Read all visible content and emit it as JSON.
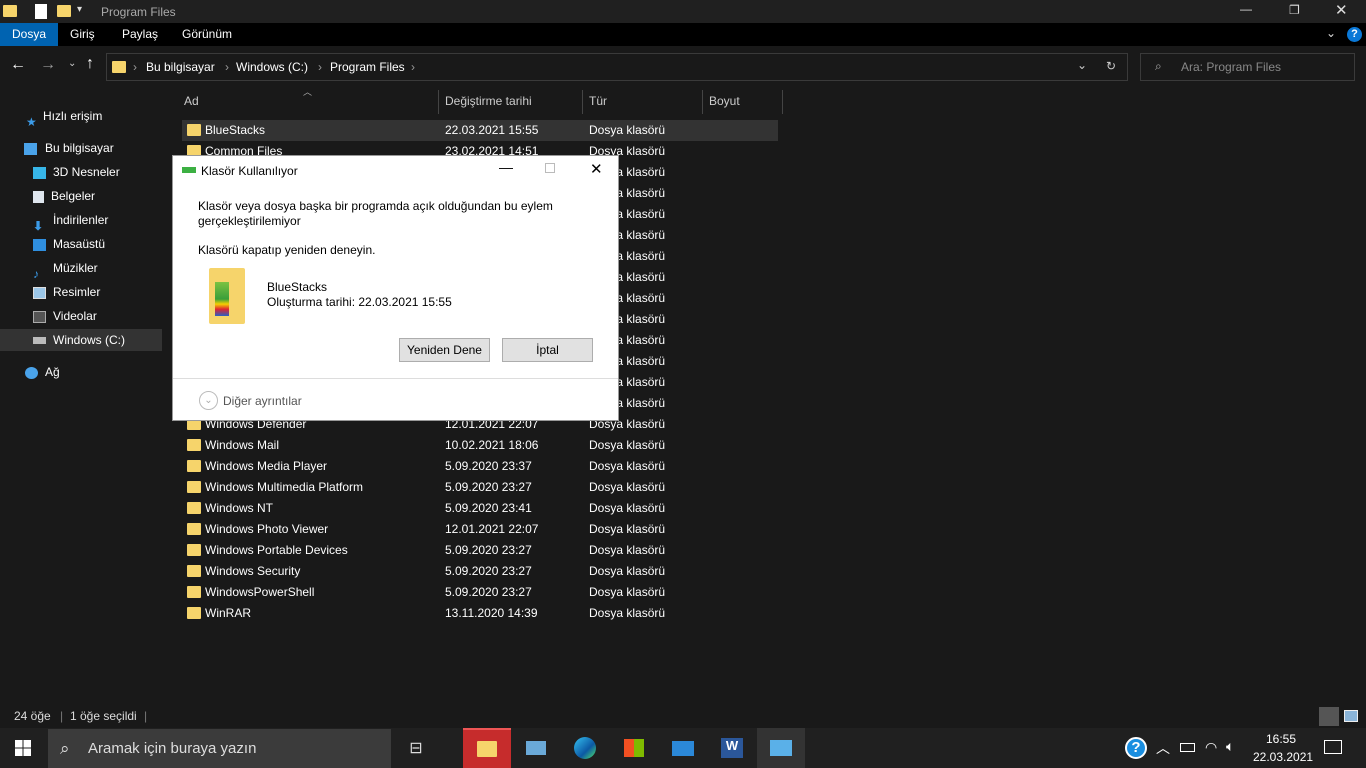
{
  "window": {
    "title": "Program Files"
  },
  "ribbon": {
    "tabs": [
      "Dosya",
      "Giriş",
      "Paylaş",
      "Görünüm"
    ]
  },
  "address": {
    "crumbs": [
      "Bu bilgisayar",
      "Windows (C:)",
      "Program Files"
    ]
  },
  "search": {
    "placeholder": "Ara: Program Files"
  },
  "sidebar": {
    "items": [
      {
        "label": "Hızlı erişim",
        "icon": "star-icon"
      },
      {
        "label": "Bu bilgisayar",
        "icon": "computer-icon"
      },
      {
        "label": "3D Nesneler",
        "icon": "cube-icon"
      },
      {
        "label": "Belgeler",
        "icon": "document-icon"
      },
      {
        "label": "İndirilenler",
        "icon": "download-icon"
      },
      {
        "label": "Masaüstü",
        "icon": "desktop-icon"
      },
      {
        "label": "Müzikler",
        "icon": "music-icon"
      },
      {
        "label": "Resimler",
        "icon": "pictures-icon"
      },
      {
        "label": "Videolar",
        "icon": "video-icon"
      },
      {
        "label": "Windows (C:)",
        "icon": "drive-icon"
      },
      {
        "label": "Ağ",
        "icon": "network-icon"
      }
    ]
  },
  "columns": [
    "Ad",
    "Değiştirme tarihi",
    "Tür",
    "Boyut"
  ],
  "files": [
    {
      "name": "BlueStacks",
      "date": "22.03.2021 15:55",
      "type": "Dosya klasörü"
    },
    {
      "name": "Common Files",
      "date": "23.02.2021 14:51",
      "type": "Dosya klasörü"
    },
    {
      "name": "",
      "date": "",
      "type": "Dosya klasörü"
    },
    {
      "name": "",
      "date": "",
      "type": "Dosya klasörü"
    },
    {
      "name": "",
      "date": "",
      "type": "Dosya klasörü"
    },
    {
      "name": "",
      "date": "",
      "type": "Dosya klasörü"
    },
    {
      "name": "",
      "date": "",
      "type": "Dosya klasörü"
    },
    {
      "name": "",
      "date": "",
      "type": "Dosya klasörü"
    },
    {
      "name": "",
      "date": "",
      "type": "Dosya klasörü"
    },
    {
      "name": "",
      "date": "",
      "type": "Dosya klasörü"
    },
    {
      "name": "",
      "date": "",
      "type": "Dosya klasörü"
    },
    {
      "name": "",
      "date": "",
      "type": "Dosya klasörü"
    },
    {
      "name": "",
      "date": "",
      "type": "Dosya klasörü"
    },
    {
      "name": "",
      "date": "",
      "type": "Dosya klasörü"
    },
    {
      "name": "Windows Defender",
      "date": "12.01.2021 22:07",
      "type": "Dosya klasörü"
    },
    {
      "name": "Windows Mail",
      "date": "10.02.2021 18:06",
      "type": "Dosya klasörü"
    },
    {
      "name": "Windows Media Player",
      "date": "5.09.2020 23:37",
      "type": "Dosya klasörü"
    },
    {
      "name": "Windows Multimedia Platform",
      "date": "5.09.2020 23:27",
      "type": "Dosya klasörü"
    },
    {
      "name": "Windows NT",
      "date": "5.09.2020 23:41",
      "type": "Dosya klasörü"
    },
    {
      "name": "Windows Photo Viewer",
      "date": "12.01.2021 22:07",
      "type": "Dosya klasörü"
    },
    {
      "name": "Windows Portable Devices",
      "date": "5.09.2020 23:27",
      "type": "Dosya klasörü"
    },
    {
      "name": "Windows Security",
      "date": "5.09.2020 23:27",
      "type": "Dosya klasörü"
    },
    {
      "name": "WindowsPowerShell",
      "date": "5.09.2020 23:27",
      "type": "Dosya klasörü"
    },
    {
      "name": "WinRAR",
      "date": "13.11.2020 14:39",
      "type": "Dosya klasörü"
    }
  ],
  "status": {
    "count": "24 öğe",
    "selected": "1 öğe seçildi"
  },
  "dialog": {
    "title": "Klasör Kullanılıyor",
    "message": "Klasör veya dosya başka bir programda açık olduğundan bu eylem gerçekleştirilemiyor",
    "hint": "Klasörü kapatıp yeniden deneyin.",
    "item_name": "BlueStacks",
    "item_created": "Oluşturma tarihi: 22.03.2021 15:55",
    "retry": "Yeniden Dene",
    "cancel": "İptal",
    "details": "Diğer ayrıntılar"
  },
  "taskbar": {
    "search_placeholder": "Aramak için buraya yazın",
    "time": "16:55",
    "date": "22.03.2021"
  },
  "colors": {
    "accent": "#0063b1",
    "folder": "#f6d46b"
  }
}
